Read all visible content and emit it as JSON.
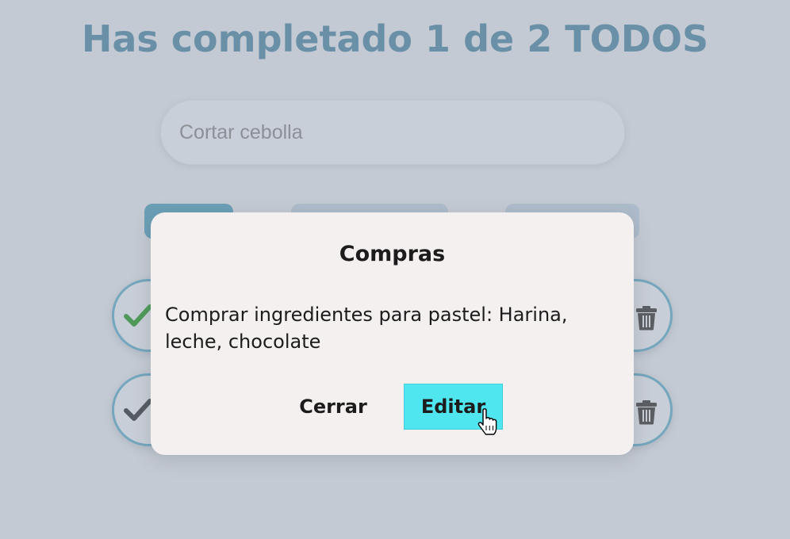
{
  "header": {
    "title": "Has completado 1 de 2 TODOS"
  },
  "search": {
    "placeholder": "Cortar cebolla"
  },
  "filters": [
    {
      "state": "selected",
      "color": "#6b9fb6"
    },
    {
      "state": "unselected",
      "color": "#aebccb"
    },
    {
      "state": "unselected",
      "color": "#aebccb"
    }
  ],
  "todos": [
    {
      "completed": true,
      "check_color": "#4f9a5a"
    },
    {
      "completed": false,
      "check_color": "#555b62"
    }
  ],
  "modal": {
    "title": "Compras",
    "text": "Comprar ingredientes para pastel: Harina, leche, chocolate",
    "close_label": "Cerrar",
    "edit_label": "Editar"
  },
  "colors": {
    "background": "#c4cad3",
    "title": "#6a90a8",
    "border_accent": "#74a6bd",
    "edit_button": "#50e6ef",
    "modal_bg": "#f5f0f0"
  }
}
